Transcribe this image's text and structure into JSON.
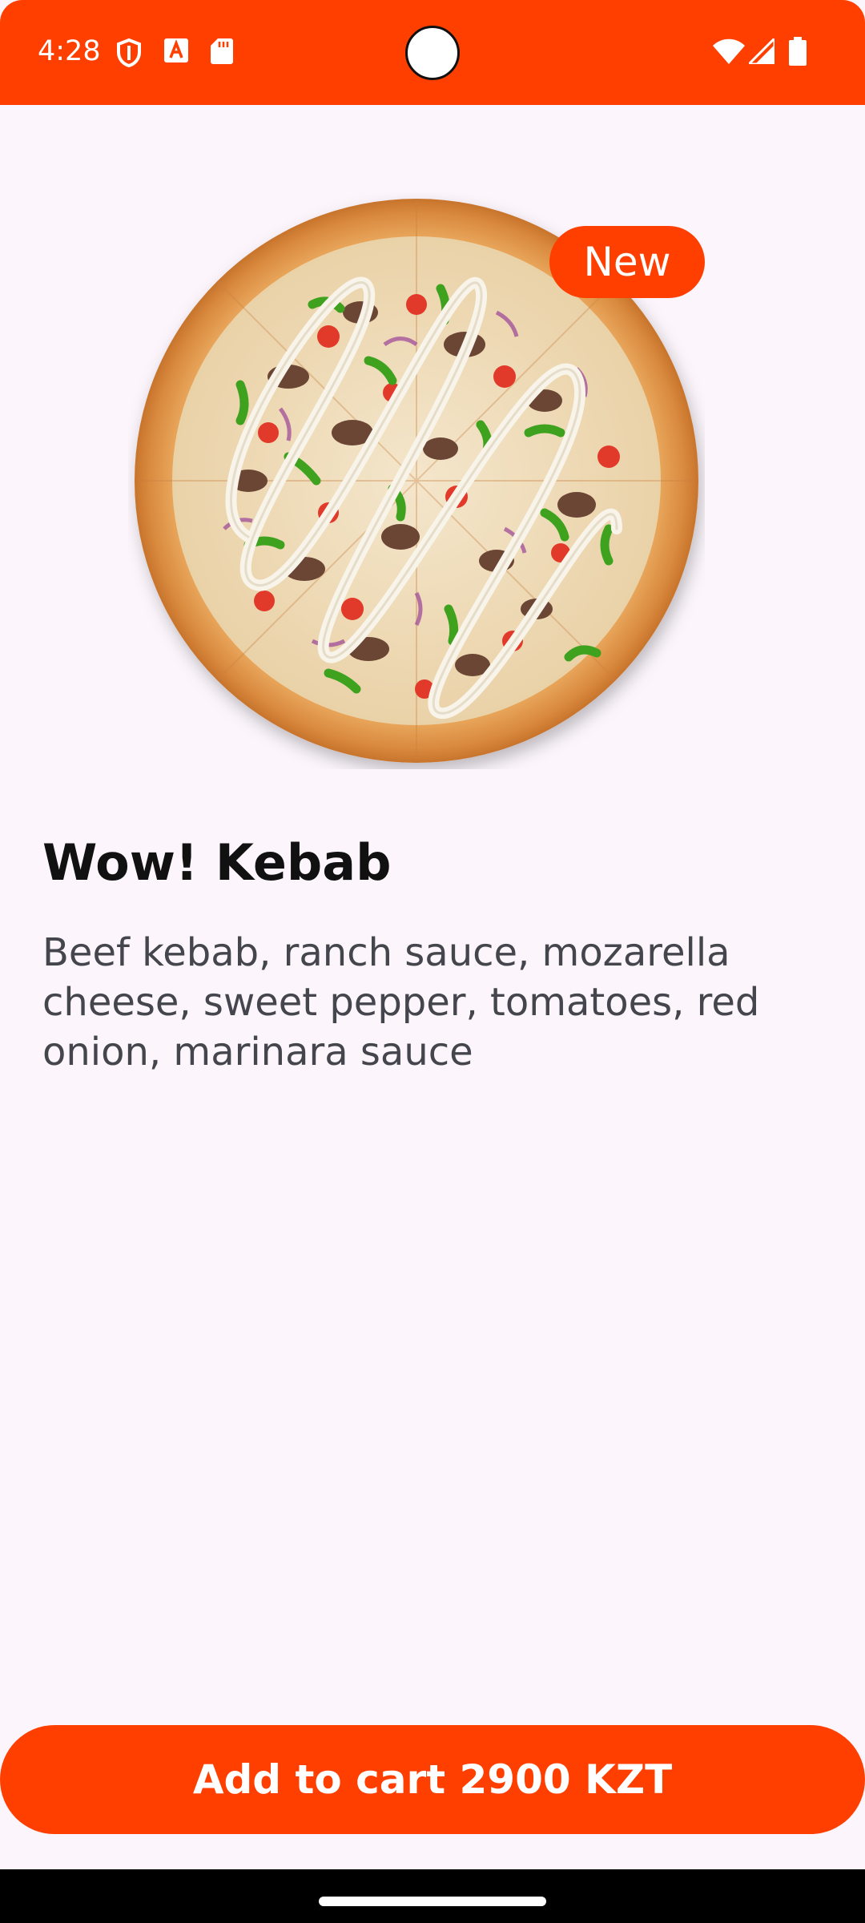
{
  "status_bar": {
    "time": "4:28",
    "left_icons": [
      "shield-icon",
      "a-box-icon",
      "sd-card-icon"
    ],
    "right_icons": [
      "wifi-icon",
      "cell-signal-icon",
      "battery-icon"
    ]
  },
  "product": {
    "badge": "New",
    "name": "Wow! Kebab",
    "description": "Beef kebab, ranch sauce, mozarella cheese, sweet pepper, tomatoes, red onion, marinara sauce"
  },
  "cart_button": {
    "label": "Add to cart 2900 KZT"
  },
  "colors": {
    "accent": "#ff3f00",
    "background": "#fcf6fc",
    "title": "#111111",
    "description": "#45464d"
  }
}
